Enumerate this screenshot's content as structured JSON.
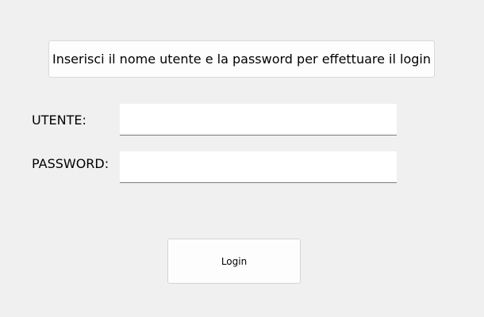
{
  "instructions": {
    "text": "Inserisci il nome utente e la password per effettuare il login"
  },
  "form": {
    "username_label": "UTENTE:",
    "username_value": "",
    "password_label": "PASSWORD:",
    "password_value": ""
  },
  "login_button": {
    "label": "Login"
  }
}
